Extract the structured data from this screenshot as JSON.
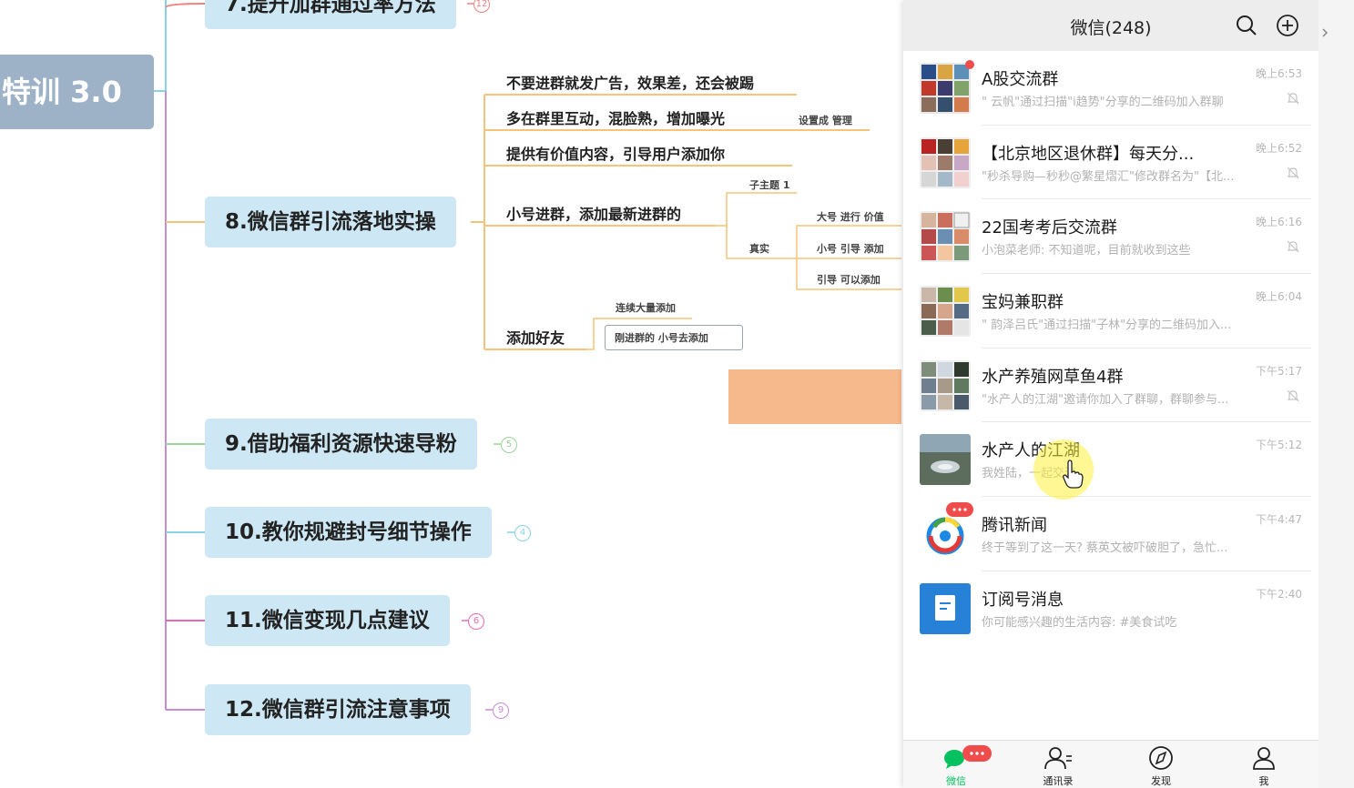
{
  "mindmap": {
    "root": "特训 3.0",
    "topics": [
      {
        "label": "7.提升加群通过率方法",
        "badge": "12",
        "color": "#f08080"
      },
      {
        "label": "8.微信群引流落地实操"
      },
      {
        "label": "9.借助福利资源快速导粉",
        "badge": "5",
        "color": "#9bd39b"
      },
      {
        "label": "10.教你规避封号细节操作",
        "badge": "4",
        "color": "#86d3e8"
      },
      {
        "label": "11.微信变现几点建议",
        "badge": "6",
        "color": "#e36ab8"
      },
      {
        "label": "12.微信群引流注意事项",
        "badge": "9",
        "color": "#c98ad8"
      }
    ],
    "subtopics": [
      "不要进群就发广告，效果差，还会被踢",
      "多在群里互动，混脸熟，增加曝光",
      "提供有价值内容，引导用户添加你",
      "小号进群，添加最新进群的",
      "添加好友"
    ],
    "minor": {
      "set_manage": "设置成 管理",
      "subtopic1": "子主题 1",
      "real": "真实",
      "big_acc": "大号 进行  价值",
      "small_guide": "小号 引导   添加",
      "guide_add": "引导  可以添加",
      "add_many": "连续大量添加",
      "new_join": "刚进群的     小号去添加"
    }
  },
  "wechat": {
    "title": "微信(248)",
    "chats": [
      {
        "name": "A股交流群",
        "preview": "\" 云帆\"通过扫描\"i趋势\"分享的二维码加入群聊",
        "time": "晚上6:53",
        "muted": true,
        "unread": true
      },
      {
        "name": "【北京地区退休群】每天分...",
        "preview": "\"秒杀导购—秒秒@繁星熠汇\"修改群名为\"【北...",
        "time": "晚上6:52",
        "muted": true
      },
      {
        "name": "22国考考后交流群",
        "preview": "小泡菜老师: 不知道呢，目前就收到这些",
        "time": "晚上6:16",
        "muted": true
      },
      {
        "name": "宝妈兼职群",
        "preview": "\" 韵泽吕氏\"通过扫描\"子林\"分享的二维码加入...",
        "time": "晚上6:04",
        "muted": false
      },
      {
        "name": "水产养殖网草鱼4群",
        "preview": "\"水产人的江湖\"邀请你加入了群聊，群聊参与...",
        "time": "下午5:17",
        "muted": true
      },
      {
        "name": "水产人的江湖",
        "preview": "我姓陆，一起交流",
        "time": "下午5:12",
        "muted": false
      },
      {
        "name": "腾讯新闻",
        "preview": "终于等到了这一天? 蔡英文被吓破胆了，急忙...",
        "time": "下午4:47",
        "muted": false
      },
      {
        "name": "订阅号消息",
        "preview": "你可能感兴趣的生活内容: #美食试吃",
        "time": "下午2:40",
        "muted": false
      }
    ],
    "tabs": [
      "微信",
      "通讯录",
      "发现",
      "我"
    ],
    "tab_badge": "..."
  }
}
